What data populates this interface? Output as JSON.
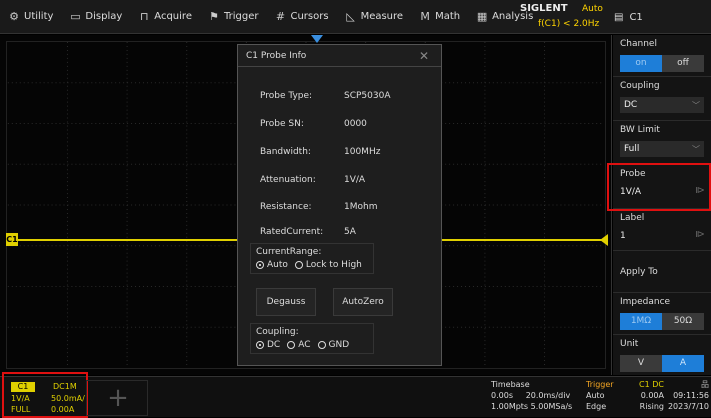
{
  "menubar": {
    "items": [
      {
        "label": "Utility",
        "icon": "gear-icon"
      },
      {
        "label": "Display",
        "icon": "display-icon"
      },
      {
        "label": "Acquire",
        "icon": "acquire-icon"
      },
      {
        "label": "Trigger",
        "icon": "trigger-flag-icon"
      },
      {
        "label": "Cursors",
        "icon": "cursors-icon"
      },
      {
        "label": "Measure",
        "icon": "measure-icon"
      },
      {
        "label": "Math",
        "icon": "math-icon"
      },
      {
        "label": "Analysis",
        "icon": "analysis-icon"
      }
    ],
    "brand": "SIGLENT",
    "run_state": "Auto",
    "trigger_status": "f(C1) < 2.0Hz",
    "channel_label": "C1"
  },
  "dialog": {
    "title": "C1 Probe Info",
    "rows": [
      {
        "key": "Probe Type:",
        "value": "SCP5030A"
      },
      {
        "key": "Probe SN:",
        "value": "0000"
      },
      {
        "key": "Bandwidth:",
        "value": "100MHz"
      },
      {
        "key": "Attenuation:",
        "value": "1V/A"
      },
      {
        "key": "Resistance:",
        "value": "1Mohm"
      },
      {
        "key": "RatedCurrent:",
        "value": "5A"
      }
    ],
    "current_range": {
      "title": "CurrentRange:",
      "options": [
        "Auto",
        "Lock to High"
      ],
      "selected": "Auto"
    },
    "buttons": {
      "degauss": "Degauss",
      "autozero": "AutoZero"
    },
    "coupling": {
      "title": "Coupling:",
      "options": [
        "DC",
        "AC",
        "GND"
      ],
      "selected": "DC"
    }
  },
  "sidepanel": {
    "channel": {
      "label": "Channel",
      "on": "on",
      "off": "off"
    },
    "coupling": {
      "label": "Coupling",
      "value": "DC"
    },
    "bw_limit": {
      "label": "BW Limit",
      "value": "Full"
    },
    "probe": {
      "label": "Probe",
      "value": "1V/A"
    },
    "label": {
      "label": "Label",
      "value": "1"
    },
    "apply_to": {
      "label": "Apply To"
    },
    "impedance": {
      "label": "Impedance",
      "opt1": "1MΩ",
      "opt2": "50Ω"
    },
    "unit": {
      "label": "Unit",
      "opt1": "V",
      "opt2": "A"
    }
  },
  "bottom": {
    "c1": {
      "tag": "C1",
      "coupling": "DC1M",
      "scale_label": "1V/A",
      "scale_value": "50.0mA/",
      "bw_label": "FULL",
      "offset": "0.00A"
    },
    "timebase": {
      "title": "Timebase",
      "delay": "0.00s",
      "scale": "20.0ms/div",
      "mem": "1.00Mpts",
      "rate": "5.00MSa/s"
    },
    "trigger": {
      "title": "Trigger",
      "mode": "Auto",
      "type": "Edge",
      "src": "C1 DC",
      "level": "0.00A",
      "slope": "Rising"
    },
    "clock": {
      "time": "09:11:56",
      "date": "2023/7/10"
    }
  },
  "colors": {
    "ch1": "#e0d000",
    "accent": "#1e7ed8",
    "highlight": "#e01010",
    "trigger": "#f5a623"
  }
}
